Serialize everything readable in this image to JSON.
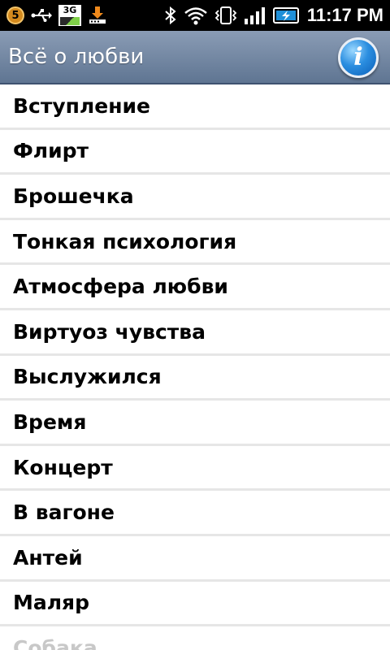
{
  "status_bar": {
    "notification_count": "5",
    "network_type": "3G",
    "time": "11:17 PM",
    "icons": [
      "notification-badge-icon",
      "usb-icon",
      "3g-icon",
      "download-icon",
      "bluetooth-icon",
      "wifi-icon",
      "vibrate-icon",
      "signal-icon",
      "battery-charging-icon"
    ]
  },
  "header": {
    "title": "Всё о любви",
    "info_icon": "info-icon",
    "info_glyph": "i"
  },
  "list": {
    "items": [
      "Вступление",
      "Флирт",
      "Брошечка",
      "Тонкая психология",
      "Атмосфера любви",
      "Виртуоз чувства",
      "Выслужился",
      "Время",
      "Концерт",
      "В вагоне",
      "Антей",
      "Маляр",
      "Собака"
    ]
  },
  "colors": {
    "title_bar": "#6f84a2",
    "divider": "#e6e6e6",
    "item_text": "#000000"
  }
}
